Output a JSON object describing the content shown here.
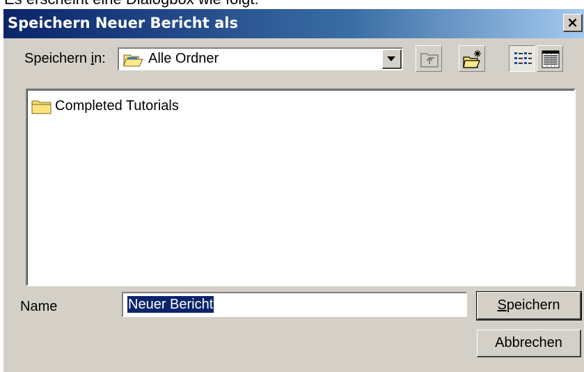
{
  "page_caption": "Es erscheint eine Dialogbox wie folgt:",
  "dialog": {
    "title": "Speichern Neuer Bericht als",
    "close_label": "×"
  },
  "save_in": {
    "label_prefix": "Speichern ",
    "label_hotkey": "i",
    "label_suffix": "n:",
    "value": "Alle Ordner"
  },
  "toolbar": {
    "icons": [
      "up-one-level-icon",
      "create-new-folder-icon",
      "list-view-icon",
      "details-view-icon"
    ]
  },
  "file_list": {
    "items": [
      {
        "label": "Completed Tutorials",
        "icon": "folder-icon"
      }
    ]
  },
  "name_field": {
    "label": "Name",
    "value": "Neuer Bericht"
  },
  "buttons": {
    "save_hotkey": "S",
    "save_rest": "peichern",
    "cancel": "Abbrechen"
  },
  "colors": {
    "titlebar_start": "#0a246a",
    "titlebar_end": "#a6caf0",
    "dialog_bg": "#d4d0c8",
    "selection": "#0a246a"
  }
}
